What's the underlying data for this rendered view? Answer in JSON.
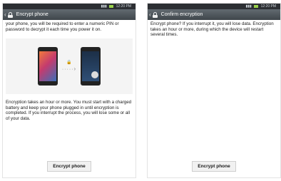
{
  "left_screen": {
    "status": {
      "time": "12:20 PM"
    },
    "title": "Encrypt phone",
    "intro_text": "your phone, you will be required to enter a numeric PIN or password to decrypt it each time you power it on.",
    "body_text": "Encryption takes an hour or more. You must start with a charged battery and keep your phone plugged in until encryption is completed. If you interrupt the process, you will lose some or all of your data.",
    "button_label": "Encrypt phone"
  },
  "right_screen": {
    "status": {
      "time": "12:20 PM"
    },
    "title": "Confirm encryption",
    "body_text": "Encrypt phone? If you interrupt it, you will lose data. Encryption takes an hour or more, during which the device will restart several times.",
    "button_label": "Encrypt phone"
  },
  "icons": {
    "back": "chevron-left-icon",
    "lock": "lock-icon",
    "signal": "signal-icon",
    "battery": "battery-icon"
  }
}
